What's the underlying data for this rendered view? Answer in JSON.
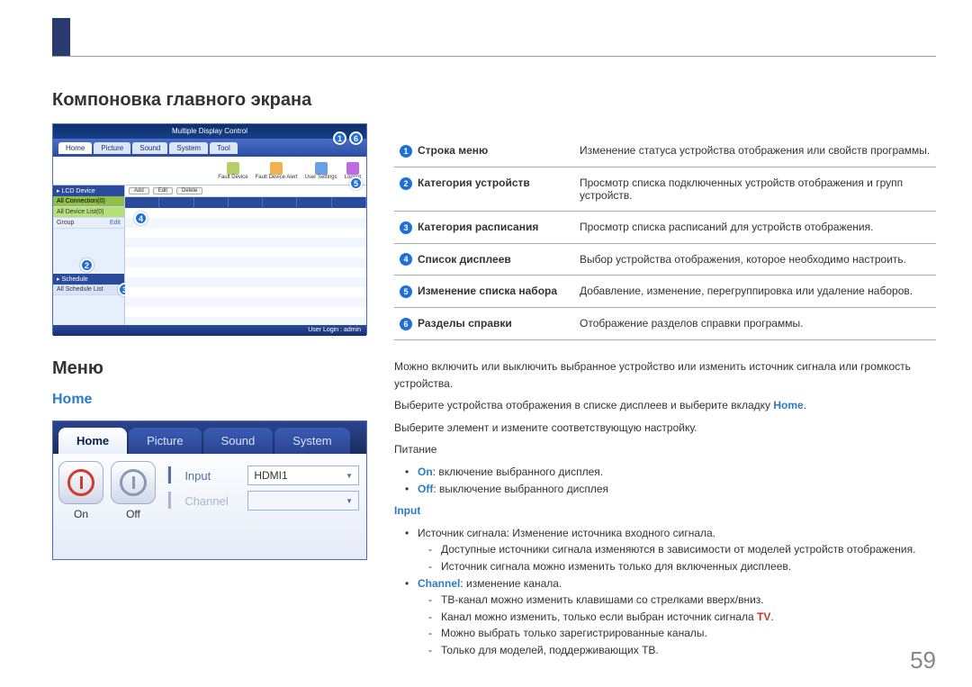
{
  "headings": {
    "layout_title": "Компоновка главного экрана",
    "menu": "Меню",
    "home": "Home"
  },
  "appshot": {
    "title": "Multiple Display Control",
    "tabs": [
      "Home",
      "Picture",
      "Sound",
      "System",
      "Tool"
    ],
    "toolbar": [
      "Fault Device",
      "Fault Device Alert",
      "User Settings",
      "Logout"
    ],
    "sidebar": {
      "lcd_header": "LCD Device",
      "row1": "All Connection(0)",
      "row2": "All Device List(0)",
      "group": "Group",
      "edit": "Edit",
      "schedule_header": "Schedule",
      "schedule_item": "All Schedule List"
    },
    "grid_controls": [
      "Add",
      "Edit",
      "Delete"
    ],
    "status": "User Login : admin"
  },
  "legend": [
    {
      "n": "1",
      "label": "Строка меню",
      "desc": "Изменение статуса устройства отображения или свойств программы."
    },
    {
      "n": "2",
      "label": "Категория устройств",
      "desc": "Просмотр списка подключенных устройств отображения и групп устройств."
    },
    {
      "n": "3",
      "label": "Категория расписания",
      "desc": "Просмотр списка расписаний для устройств отображения."
    },
    {
      "n": "4",
      "label": "Список дисплеев",
      "desc": "Выбор устройства отображения, которое необходимо настроить."
    },
    {
      "n": "5",
      "label": "Изменение списка набора",
      "desc": "Добавление, изменение, перегруппировка или удаление наборов."
    },
    {
      "n": "6",
      "label": "Разделы справки",
      "desc": "Отображение разделов справки программы."
    }
  ],
  "ui2": {
    "tabs": [
      "Home",
      "Picture",
      "Sound",
      "System"
    ],
    "on": "On",
    "off": "Off",
    "input_label": "Input",
    "channel_label": "Channel",
    "input_value": "HDMI1"
  },
  "menu_text": {
    "p1": "Можно включить или выключить выбранное устройство или изменить источник сигнала или громкость устройства.",
    "p2_pre": "Выберите устройства отображения в списке дисплеев и выберите вкладку ",
    "p2_kw": "Home",
    "p2_post": ".",
    "p3": "Выберите элемент и измените соответствующую настройку.",
    "power_label": "Питание",
    "on_kw": "On",
    "on_txt": ": включение выбранного дисплея.",
    "off_kw": "Off",
    "off_txt": ": выключение выбранного дисплея",
    "input_kw": "Input",
    "src_txt": "Источник сигнала: Изменение источника входного сигнала.",
    "src_sub1": "Доступные источники сигнала изменяются в зависимости от моделей устройств отображения.",
    "src_sub2": "Источник сигнала можно изменить только для включенных дисплеев.",
    "channel_kw": "Channel",
    "channel_txt": ": изменение канала.",
    "ch_sub1": "ТВ-канал можно изменить клавишами со стрелками вверх/вниз.",
    "ch_sub2_pre": "Канал можно изменить, только если выбран источник сигнала ",
    "ch_sub2_kw": "TV",
    "ch_sub2_post": ".",
    "ch_sub3": "Можно выбрать только зарегистрированные каналы.",
    "ch_sub4": "Только для моделей, поддерживающих ТВ."
  },
  "page_number": "59"
}
